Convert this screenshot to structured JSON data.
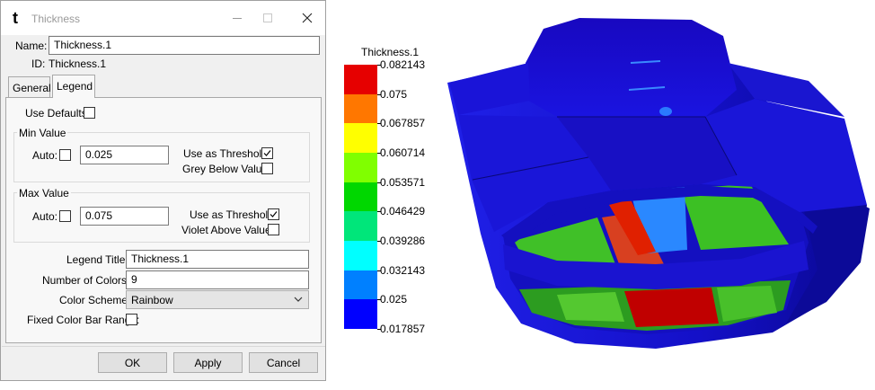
{
  "window": {
    "title": "Thickness",
    "app_icon": "t-logo-icon"
  },
  "form": {
    "name_label": "Name:",
    "name_value": "Thickness.1",
    "id_label": "ID:",
    "id_value": "Thickness.1"
  },
  "tabs": [
    {
      "label": "General",
      "active": false
    },
    {
      "label": "Legend",
      "active": true
    }
  ],
  "legend_tab": {
    "use_defaults_label": "Use Defaults:",
    "use_defaults_checked": false,
    "min_group": {
      "title": "Min Value",
      "auto_label": "Auto:",
      "auto_checked": false,
      "value": "0.025",
      "threshold_label": "Use as Threshold:",
      "threshold_checked": true,
      "below_label": "Grey Below Value:",
      "below_checked": false
    },
    "max_group": {
      "title": "Max Value",
      "auto_label": "Auto:",
      "auto_checked": false,
      "value": "0.075",
      "threshold_label": "Use as Threshold:",
      "threshold_checked": true,
      "above_label": "Violet Above Value:",
      "above_checked": false
    },
    "legend_title_label": "Legend Title:",
    "legend_title_value": "Thickness.1",
    "num_colors_label": "Number of Colors:",
    "num_colors_value": "9",
    "color_scheme_label": "Color Scheme:",
    "color_scheme_value": "Rainbow",
    "fixed_range_label": "Fixed Color Bar Range:",
    "fixed_range_checked": false
  },
  "buttons": {
    "ok": "OK",
    "apply": "Apply",
    "cancel": "Cancel"
  },
  "legend": {
    "title": "Thickness.1",
    "swatches": [
      "#e60000",
      "#ff7700",
      "#ffff00",
      "#80ff00",
      "#00d700",
      "#00e67a",
      "#00ffff",
      "#0080ff",
      "#0000ff"
    ],
    "labels": [
      "0.082143",
      "0.075",
      "0.067857",
      "0.060714",
      "0.053571",
      "0.046429",
      "0.039286",
      "0.032143",
      "0.025",
      "0.017857"
    ]
  },
  "colors": {
    "model_blue": "#1a10d8",
    "model_dark_blue": "#0a0870",
    "model_green": "#3cc024",
    "model_red": "#c80000",
    "model_light_blue": "#1e78ff"
  }
}
